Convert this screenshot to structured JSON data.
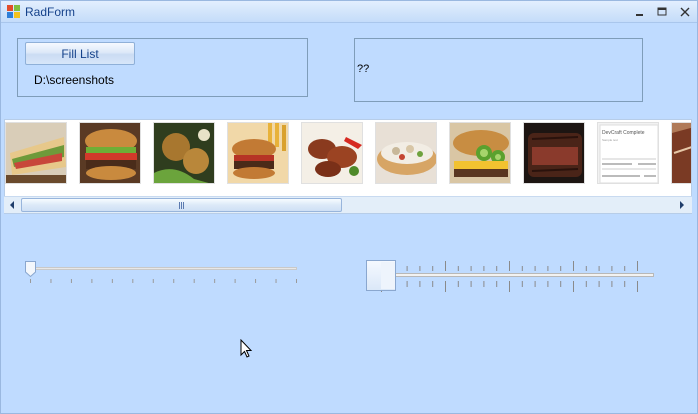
{
  "window": {
    "title": "RadForm"
  },
  "title_bar": {
    "minimize_icon": "minimize-icon",
    "maximize_icon": "maximize-icon",
    "close_icon": "close-icon"
  },
  "group_left": {
    "button_label": "Fill List",
    "path_text": "D:\\screenshots"
  },
  "group_right": {
    "text": "??"
  },
  "thumbnails": [
    {
      "name": "thumb-sandwich"
    },
    {
      "name": "thumb-burger"
    },
    {
      "name": "thumb-fritters"
    },
    {
      "name": "thumb-burger-fries"
    },
    {
      "name": "thumb-grilled-chicken"
    },
    {
      "name": "thumb-hotdog"
    },
    {
      "name": "thumb-jalapeno-burger"
    },
    {
      "name": "thumb-steak"
    },
    {
      "name": "thumb-document-screenshot"
    },
    {
      "name": "thumb-meat-partial"
    }
  ],
  "screenshot_thumb": {
    "title": "DevCraft Complete",
    "subtitle": "Sample text"
  },
  "scrollbar": {
    "left_icon": "scroll-left-icon",
    "right_icon": "scroll-right-icon",
    "position_fraction": 0.0,
    "visible_fraction": 0.47
  },
  "trackbar_left": {
    "value_fraction": 0.0,
    "tick_count": 14
  },
  "trackbar_right": {
    "value_fraction": 0.0,
    "tick_count": 21
  },
  "colors": {
    "background": "#bfdbff",
    "title_text": "#15428b",
    "border": "#7f9db9"
  }
}
